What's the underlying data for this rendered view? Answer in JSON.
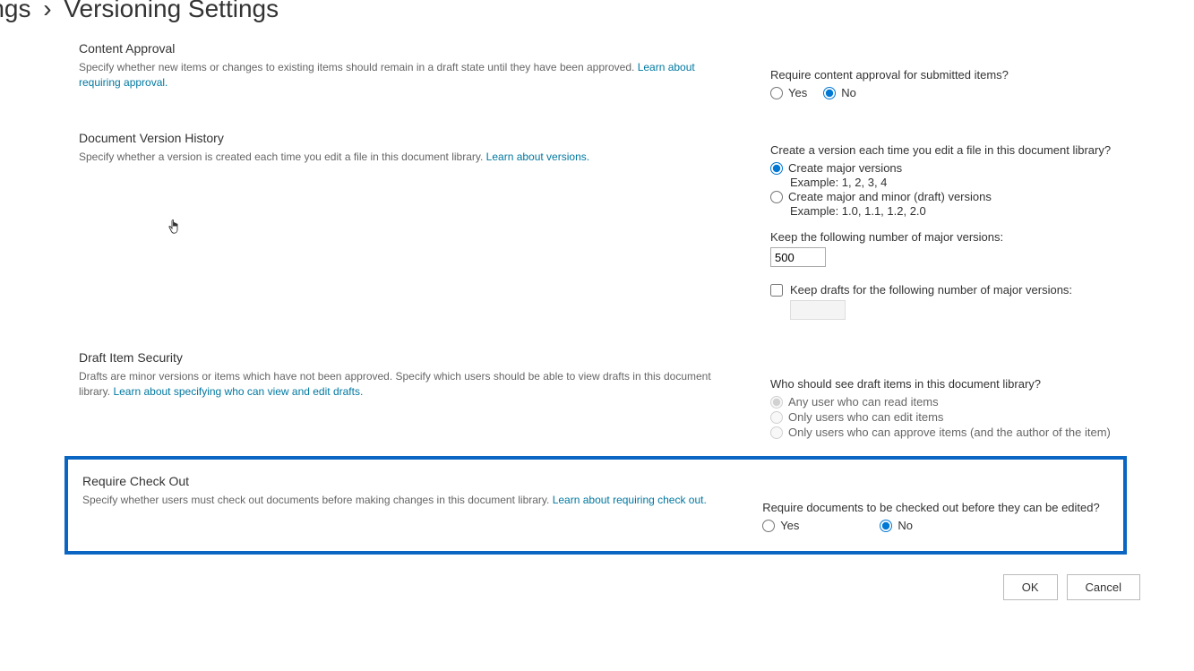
{
  "breadcrumb": {
    "parent_fragment": "ettings",
    "sep": "›",
    "current": "Versioning Settings"
  },
  "sections": {
    "content_approval": {
      "title": "Content Approval",
      "desc": "Specify whether new items or changes to existing items should remain in a draft state until they have been approved.  ",
      "learn": "Learn about requiring approval.",
      "question": "Require content approval for submitted items?",
      "yes": "Yes",
      "no": "No"
    },
    "version_history": {
      "title": "Document Version History",
      "desc": "Specify whether a version is created each time you edit a file in this document library.  ",
      "learn": "Learn about versions.",
      "question": "Create a version each time you edit a file in this document library?",
      "opt_major": "Create major versions",
      "opt_major_example": "Example: 1, 2, 3, 4",
      "opt_minor": "Create major and minor (draft) versions",
      "opt_minor_example": "Example: 1.0, 1.1, 1.2, 2.0",
      "keep_major_label": "Keep the following number of major versions:",
      "keep_major_value": "500",
      "keep_drafts_label": "Keep drafts for the following number of major versions:",
      "keep_drafts_value": ""
    },
    "draft_security": {
      "title": "Draft Item Security",
      "desc": "Drafts are minor versions or items which have not been approved. Specify which users should be able to view drafts in this document library.  ",
      "learn": "Learn about specifying who can view and edit drafts.",
      "question": "Who should see draft items in this document library?",
      "opt_any": "Any user who can read items",
      "opt_edit": "Only users who can edit items",
      "opt_approve": "Only users who can approve items (and the author of the item)"
    },
    "require_checkout": {
      "title": "Require Check Out",
      "desc": "Specify whether users must check out documents before making changes in this document library.  ",
      "learn": "Learn about requiring check out.",
      "question": "Require documents to be checked out before they can be edited?",
      "yes": "Yes",
      "no": "No"
    }
  },
  "buttons": {
    "ok": "OK",
    "cancel": "Cancel"
  }
}
